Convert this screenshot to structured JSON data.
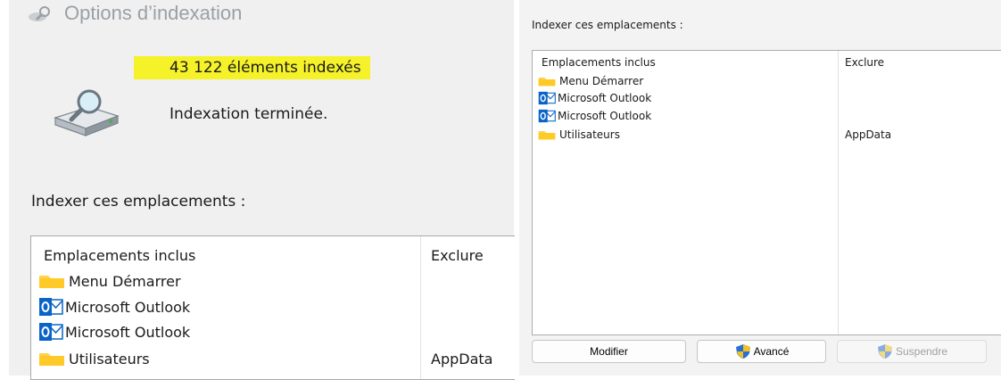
{
  "left": {
    "title": "Options d’indexation",
    "count": "43 122 éléments indexés",
    "status": "Indexation terminée.",
    "locations_label": "Indexer ces emplacements :",
    "table": {
      "col_included": "Emplacements inclus",
      "col_exclude": "Exclure",
      "rows": [
        {
          "icon": "folder-icon",
          "name": "Menu Démarrer",
          "exclude": ""
        },
        {
          "icon": "outlook-icon",
          "name": "Microsoft Outlook",
          "exclude": ""
        },
        {
          "icon": "outlook-icon",
          "name": "Microsoft Outlook",
          "exclude": ""
        },
        {
          "icon": "folder-icon",
          "name": "Utilisateurs",
          "exclude": "AppData"
        }
      ]
    }
  },
  "right": {
    "locations_label": "Indexer ces emplacements :",
    "table": {
      "col_included": "Emplacements inclus",
      "col_exclude": "Exclure",
      "rows": [
        {
          "icon": "folder-icon",
          "name": "Menu Démarrer",
          "exclude": ""
        },
        {
          "icon": "outlook-icon",
          "name": "Microsoft Outlook",
          "exclude": ""
        },
        {
          "icon": "outlook-icon",
          "name": "Microsoft Outlook",
          "exclude": ""
        },
        {
          "icon": "folder-icon",
          "name": "Utilisateurs",
          "exclude": "AppData"
        }
      ]
    },
    "buttons": {
      "modify": "Modifier",
      "advanced": "Avancé",
      "suspend": "Suspendre"
    }
  },
  "colors": {
    "highlight": "#f5f22a",
    "folder": "#ffd24a",
    "outlook": "#0a64c8",
    "shield_blue": "#2a6fd4",
    "shield_yellow": "#f2c11c"
  }
}
